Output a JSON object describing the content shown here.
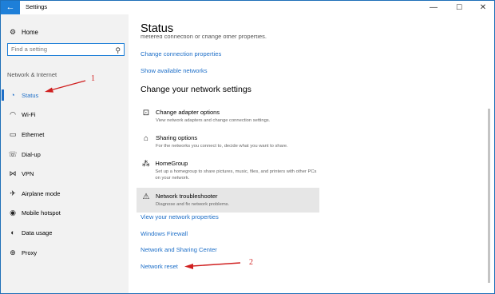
{
  "window": {
    "title": "Settings",
    "back_glyph": "←",
    "minimize_glyph": "—",
    "maximize_glyph": "☐",
    "close_glyph": "✕"
  },
  "sidebar": {
    "home_label": "Home",
    "search_placeholder": "Find a setting",
    "section_label": "Network & Internet",
    "items": [
      {
        "label": "Status",
        "icon": "globe-icon",
        "glyph": "◔",
        "active": true
      },
      {
        "label": "Wi-Fi",
        "icon": "wifi-icon",
        "glyph": "◠",
        "active": false
      },
      {
        "label": "Ethernet",
        "icon": "ethernet-icon",
        "glyph": "▭",
        "active": false
      },
      {
        "label": "Dial-up",
        "icon": "dialup-icon",
        "glyph": "☏",
        "active": false
      },
      {
        "label": "VPN",
        "icon": "vpn-icon",
        "glyph": "⋈",
        "active": false
      },
      {
        "label": "Airplane mode",
        "icon": "airplane-icon",
        "glyph": "✈",
        "active": false
      },
      {
        "label": "Mobile hotspot",
        "icon": "hotspot-icon",
        "glyph": "◉",
        "active": false
      },
      {
        "label": "Data usage",
        "icon": "data-usage-icon",
        "glyph": "◐",
        "active": false
      },
      {
        "label": "Proxy",
        "icon": "proxy-icon",
        "glyph": "⊕",
        "active": false
      }
    ]
  },
  "main": {
    "title": "Status",
    "cutoff_text": "metered connection or change other properties.",
    "links_top": {
      "change_connection_properties": "Change connection properties",
      "show_available_networks": "Show available networks"
    },
    "section_title": "Change your network settings",
    "options": [
      {
        "title": "Change adapter options",
        "desc": "View network adapters and change connection settings.",
        "icon": "adapter-icon",
        "glyph": "⊡"
      },
      {
        "title": "Sharing options",
        "desc": "For the networks you connect to, decide what you want to share.",
        "icon": "sharing-icon",
        "glyph": "⌂"
      },
      {
        "title": "HomeGroup",
        "desc": "Set up a homegroup to share pictures, music, files, and printers with other PCs on your network.",
        "icon": "homegroup-icon",
        "glyph": "⁂"
      },
      {
        "title": "Network troubleshooter",
        "desc": "Diagnose and fix network problems.",
        "icon": "warning-icon",
        "glyph": "⚠"
      }
    ],
    "links_bottom": {
      "view_network_properties": "View your network properties",
      "windows_firewall": "Windows Firewall",
      "network_sharing_center": "Network and Sharing Center",
      "network_reset": "Network reset"
    }
  },
  "annotations": {
    "marker_1": "1",
    "marker_2": "2",
    "color": "#d02020"
  },
  "colors": {
    "accent": "#1e6fc8",
    "titlebar_back": "#1e7fd8",
    "sidebar_bg": "#f2f2f2",
    "highlight_bg": "#e6e6e6"
  }
}
